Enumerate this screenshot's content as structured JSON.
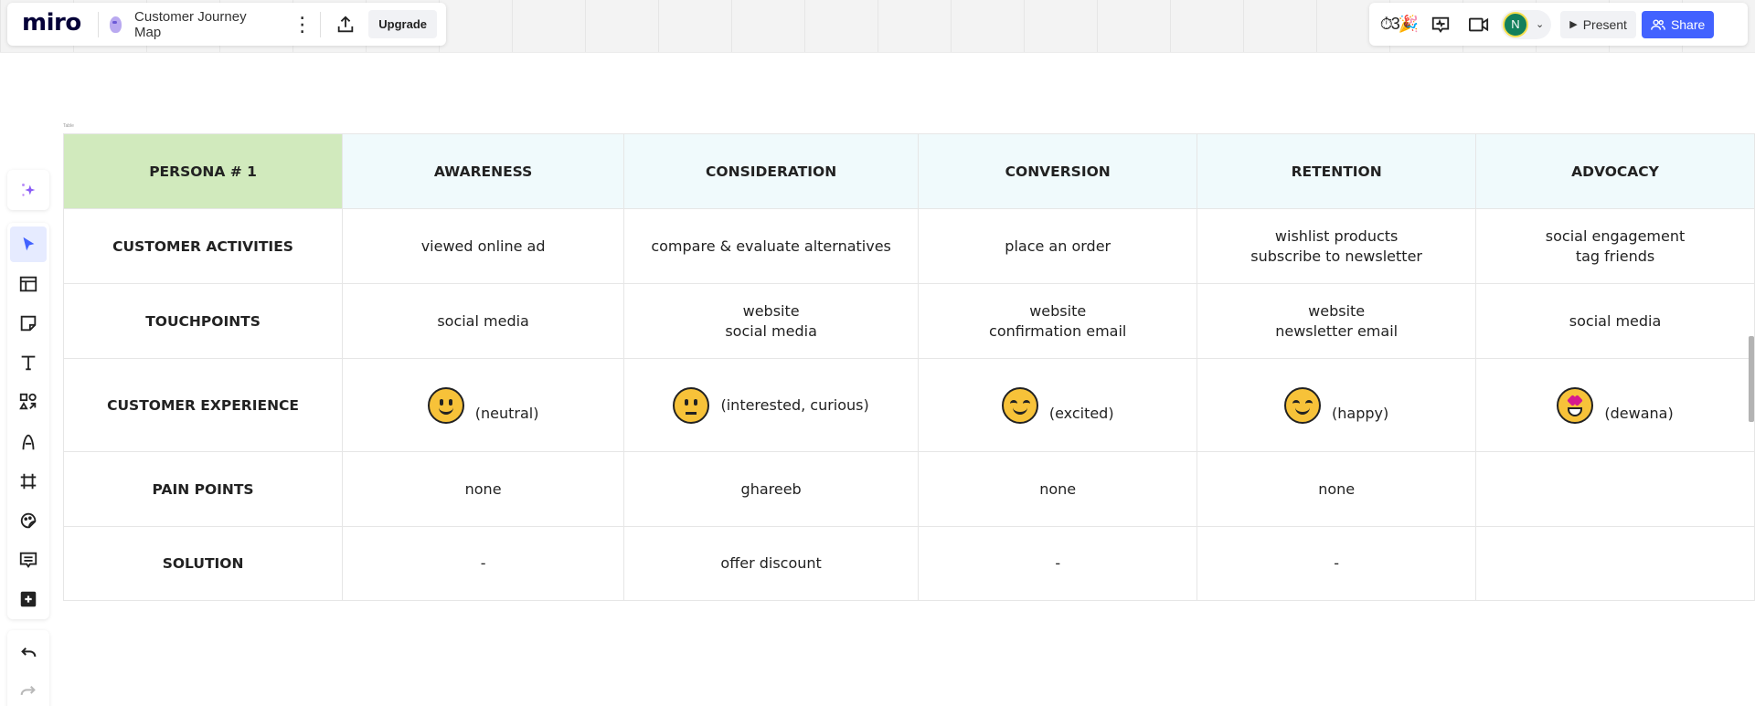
{
  "app": {
    "logo": "miro",
    "board_title": "Customer Journey Map",
    "upgrade_label": "Upgrade",
    "more_icon": "kebab-menu-icon",
    "export_icon": "upload-icon"
  },
  "top_right": {
    "reactions_glyph": "⏱3🎉",
    "user_initial": "N",
    "present_label": "Present",
    "share_label": "Share",
    "colors": {
      "share": "#4262ff",
      "avatar": "#12805c"
    }
  },
  "toolbar": {
    "tools": [
      {
        "name": "select",
        "active": true
      },
      {
        "name": "templates"
      },
      {
        "name": "sticky-note"
      },
      {
        "name": "text"
      },
      {
        "name": "shapes"
      },
      {
        "name": "pen"
      },
      {
        "name": "frame"
      },
      {
        "name": "stickers"
      },
      {
        "name": "comment"
      },
      {
        "name": "more-apps"
      }
    ]
  },
  "table": {
    "label": "Table",
    "header": [
      "PERSONA # 1",
      "AWARENESS",
      "CONSIDERATION",
      "CONVERSION",
      "RETENTION",
      "ADVOCACY"
    ],
    "rows": [
      {
        "label": "CUSTOMER ACTIVITIES",
        "cells": [
          [
            "viewed online ad"
          ],
          [
            "compare & evaluate alternatives"
          ],
          [
            "place an order"
          ],
          [
            "wishlist products",
            "subscribe to newsletter"
          ],
          [
            "social engagement",
            "tag friends"
          ]
        ]
      },
      {
        "label": "TOUCHPOINTS",
        "cells": [
          [
            "social media"
          ],
          [
            "website",
            "social media"
          ],
          [
            "website",
            "confirmation email"
          ],
          [
            "website",
            "newsletter email"
          ],
          [
            "social media"
          ]
        ]
      },
      {
        "label": "CUSTOMER EXPERIENCE",
        "emotions": [
          {
            "emoji": "slightly-smiling-face",
            "text": "(neutral)"
          },
          {
            "emoji": "face-with-raised-eyebrow",
            "text": "(interested, curious)"
          },
          {
            "emoji": "smiling-face-with-smiling-eyes",
            "text": "(excited)"
          },
          {
            "emoji": "smiling-face-with-smiling-eyes",
            "text": "(happy)"
          },
          {
            "emoji": "star-struck",
            "text": "(dewana)"
          }
        ]
      },
      {
        "label": "PAIN POINTS",
        "cells": [
          [
            "none"
          ],
          [
            "ghareeb"
          ],
          [
            "none"
          ],
          [
            "none"
          ],
          [
            ""
          ]
        ]
      },
      {
        "label": "SOLUTION",
        "cells": [
          [
            "-"
          ],
          [
            "offer discount"
          ],
          [
            "-"
          ],
          [
            "-"
          ],
          [
            ""
          ]
        ]
      }
    ],
    "colors": {
      "persona_header": "#d1eabd",
      "stage_header": "#f0fafc",
      "border": "#e6e6e6"
    }
  }
}
